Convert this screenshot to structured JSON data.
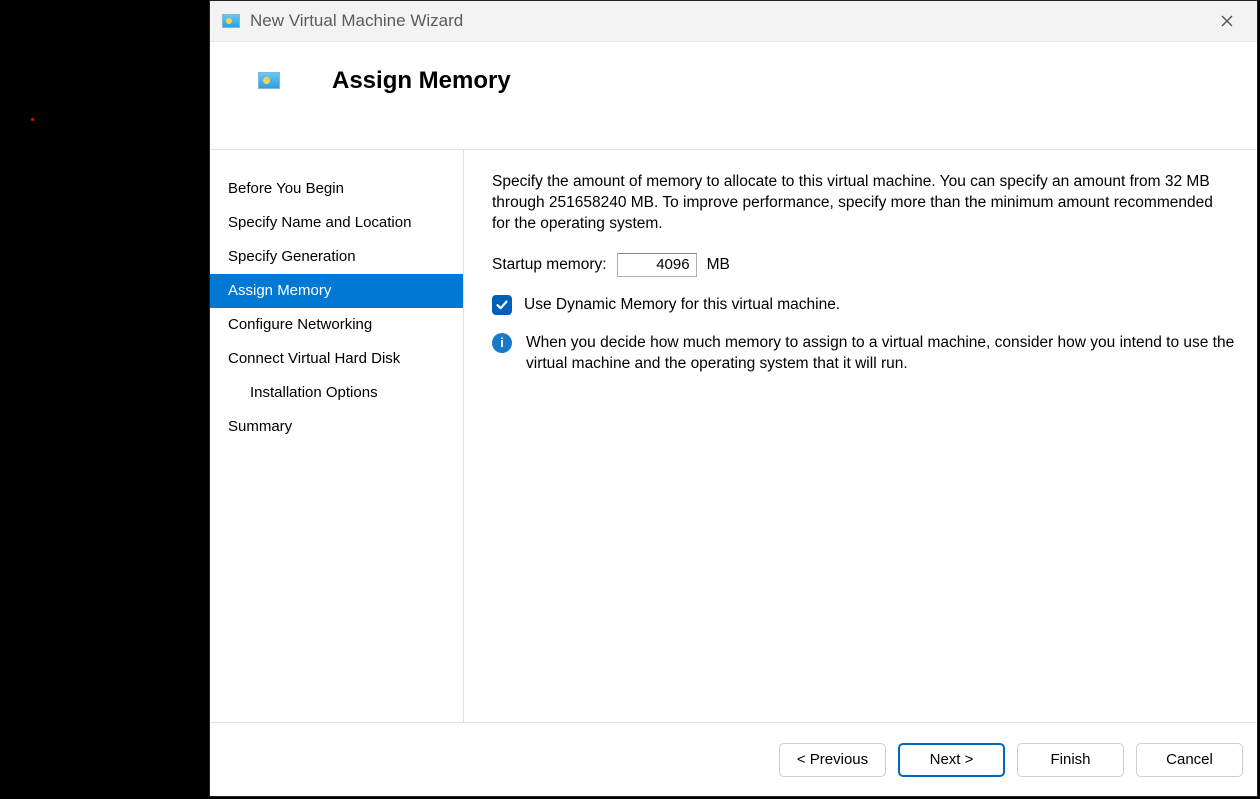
{
  "window": {
    "title": "New Virtual Machine Wizard"
  },
  "header": {
    "title": "Assign Memory"
  },
  "sidebar": {
    "items": [
      {
        "label": "Before You Begin"
      },
      {
        "label": "Specify Name and Location"
      },
      {
        "label": "Specify Generation"
      },
      {
        "label": "Assign Memory"
      },
      {
        "label": "Configure Networking"
      },
      {
        "label": "Connect Virtual Hard Disk"
      },
      {
        "label": "Installation Options"
      },
      {
        "label": "Summary"
      }
    ],
    "active_index": 3,
    "indent_indices": [
      6
    ]
  },
  "content": {
    "description": "Specify the amount of memory to allocate to this virtual machine. You can specify an amount from 32 MB through 251658240 MB. To improve performance, specify more than the minimum amount recommended for the operating system.",
    "startup_label": "Startup memory:",
    "startup_value": "4096",
    "startup_unit": "MB",
    "dynamic_memory_label": "Use Dynamic Memory for this virtual machine.",
    "dynamic_memory_checked": true,
    "info_text": "When you decide how much memory to assign to a virtual machine, consider how you intend to use the virtual machine and the operating system that it will run."
  },
  "footer": {
    "previous": "< Previous",
    "next": "Next >",
    "finish": "Finish",
    "cancel": "Cancel"
  }
}
